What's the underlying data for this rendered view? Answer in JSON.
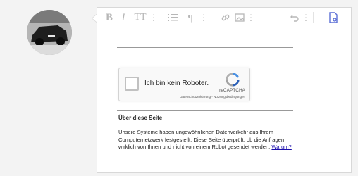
{
  "toolbar": {
    "bold_label": "B",
    "italic_label": "I",
    "text_size_label": "TT",
    "paragraph_label": "¶"
  },
  "captcha": {
    "checkbox_label": "Ich bin kein Roboter.",
    "brand": "reCAPTCHA",
    "privacy_link": "Datenschutzerklärung",
    "terms_link": "Nutzungsbedingungen",
    "link_separator": " - "
  },
  "about": {
    "title": "Über diese Seite",
    "text": "Unsere Systeme haben ungewöhnlichen Datenverkehr aus Ihrem Computernetzwerk festgestellt. Diese Seite überprüft, ob die Anfragen wirklich von Ihnen und nicht von einem Robot gesendet werden. ",
    "why_link": "Warum?"
  },
  "colors": {
    "accent": "#5b6fd6",
    "link": "#1a0dab",
    "recaptcha_blue": "#4a90e2"
  },
  "icons": [
    "avatar-photo",
    "bold-icon",
    "italic-icon",
    "text-size-icon",
    "more-icon",
    "list-icon",
    "paragraph-icon",
    "link-icon",
    "image-icon",
    "undo-icon",
    "document-icon",
    "recaptcha-logo-icon"
  ]
}
